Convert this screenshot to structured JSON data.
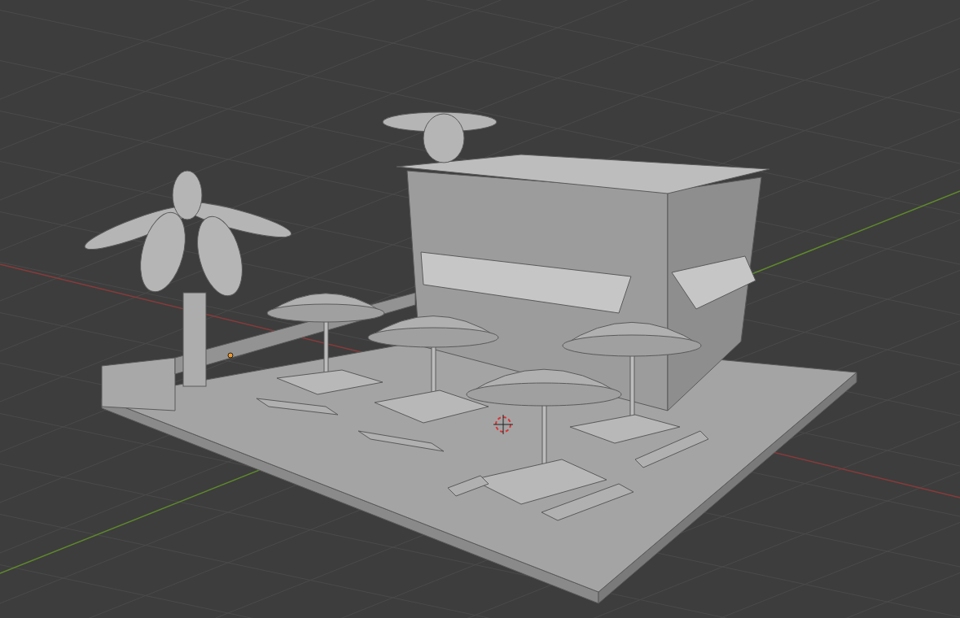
{
  "viewport": {
    "grid_visible": true,
    "x_axis": {
      "color": "#8a3a3a"
    },
    "y_axis": {
      "color": "#5f8a2a"
    }
  }
}
